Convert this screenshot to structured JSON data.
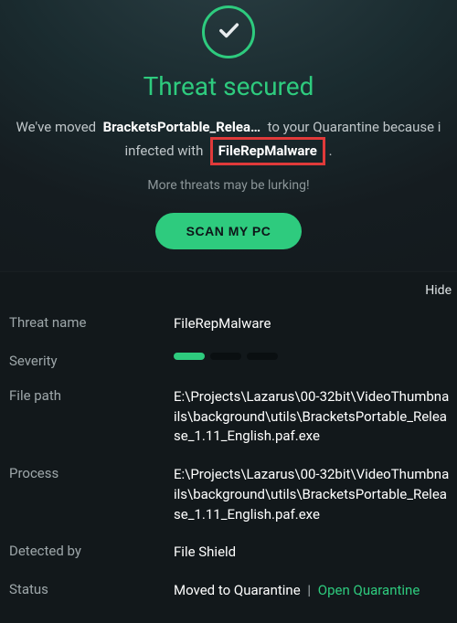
{
  "header": {
    "title": "Threat secured",
    "desc_prefix": "We've moved",
    "file_partial": "BracketsPortable_Relea…",
    "desc_mid": "to your Quarantine because i",
    "desc_line2_prefix": "infected with",
    "threat_highlight": "FileRepMalware",
    "period": ".",
    "more_threats": "More threats may be lurking!",
    "scan_label": "SCAN MY PC"
  },
  "details": {
    "hide_label": "Hide",
    "rows": {
      "threat_name": {
        "label": "Threat name",
        "value": "FileRepMalware"
      },
      "severity": {
        "label": "Severity",
        "level": 1,
        "max": 3
      },
      "file_path": {
        "label": "File path",
        "value": "E:\\Projects\\Lazarus\\00-32bit\\VideoThumbnails\\background\\utils\\BracketsPortable_Release_1.11_English.paf.exe"
      },
      "process": {
        "label": "Process",
        "value": "E:\\Projects\\Lazarus\\00-32bit\\VideoThumbnails\\background\\utils\\BracketsPortable_Release_1.11_English.paf.exe"
      },
      "detected_by": {
        "label": "Detected by",
        "value": "File Shield"
      },
      "status": {
        "label": "Status",
        "value": "Moved to Quarantine",
        "link": "Open Quarantine",
        "sep": "|"
      }
    }
  }
}
